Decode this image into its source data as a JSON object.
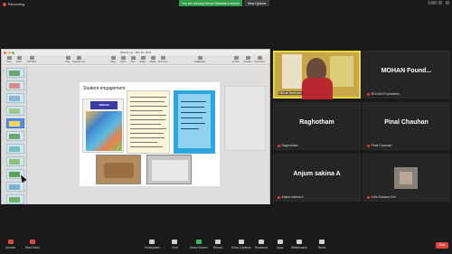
{
  "topbar": {
    "recording_label": "Recording",
    "share_banner": "You are viewing Nirmal Badhake's screen",
    "view_options": "View Options"
  },
  "shared_window": {
    "title": "Slide11 (1) - Mar 10, 2021",
    "toolbar": [
      "View",
      "Zoom",
      "Add Slide",
      "Play",
      "Keynote Live",
      "Table",
      "Chart",
      "Text",
      "Shape",
      "Media",
      "Comment",
      "Collaborate",
      "Format",
      "Animate",
      "Document"
    ],
    "slide_title": "Student engagement",
    "poster_brand": "MOHAN"
  },
  "participants": [
    {
      "display": "",
      "name": "Nirmal Badhake",
      "has_video": true
    },
    {
      "display": "MOHAN  Found...",
      "name": "MOHAN Foundation",
      "has_video": false
    },
    {
      "display": "Raghotham",
      "name": "Raghotham",
      "has_video": false
    },
    {
      "display": "Pinal Chauhan",
      "name": "Pinal Chauhan",
      "has_video": false
    },
    {
      "display": "Anjum sakina A",
      "name": "Anjum sakina A",
      "has_video": false
    },
    {
      "display": "",
      "name": "Jolla Sukana Dixt",
      "has_video": false
    }
  ],
  "bottombar": {
    "unmute": "Unmute",
    "start_video": "Start Video",
    "participants": "Participants",
    "chat": "Chat",
    "share_screen": "Share Screen",
    "record": "Record",
    "show_captions": "Show Captions",
    "reactions": "Reactions",
    "apps": "Apps",
    "whiteboards": "Whiteboards",
    "notes": "Notes",
    "end": "End"
  },
  "colors": {
    "share_banner": "#2e9b47",
    "active_speaker": "#e7d83b",
    "end_button": "#e0463b",
    "selected_thumb": "#2b7cff"
  }
}
